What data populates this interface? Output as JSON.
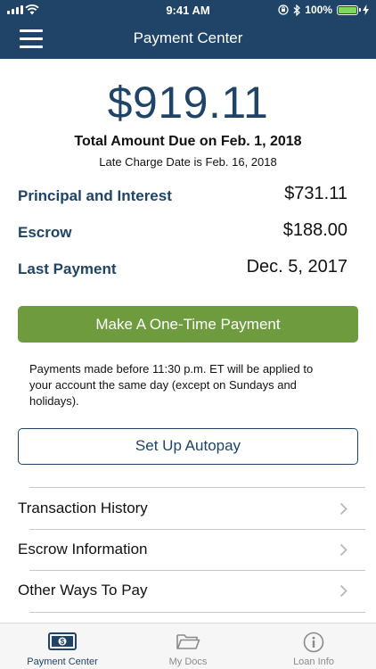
{
  "status_bar": {
    "time": "9:41 AM",
    "battery_percent": "100%",
    "battery_level": 1.0
  },
  "nav": {
    "title": "Payment Center"
  },
  "payment": {
    "amount": "$919.11",
    "due_text": "Total Amount Due on Feb. 1, 2018",
    "late_text": "Late Charge Date is Feb. 16, 2018"
  },
  "details": [
    {
      "label": "Principal and Interest",
      "value": "$731.11"
    },
    {
      "label": "Escrow",
      "value": "$188.00"
    },
    {
      "label": "Last Payment",
      "value": "Dec. 5, 2017"
    }
  ],
  "buttons": {
    "one_time": "Make A One-Time Payment",
    "autopay": "Set Up Autopay"
  },
  "note": "Payments made before 11:30 p.m. ET will be applied to your account the same day (except on Sundays and holidays).",
  "menu_items": [
    {
      "label": "Transaction History"
    },
    {
      "label": "Escrow Information"
    },
    {
      "label": "Other Ways To Pay"
    }
  ],
  "tabs": [
    {
      "label": "Payment Center",
      "icon": "dollar-bill-icon",
      "active": true
    },
    {
      "label": "My Docs",
      "icon": "folder-icon",
      "active": false
    },
    {
      "label": "Loan Info",
      "icon": "info-icon",
      "active": false
    }
  ],
  "colors": {
    "brand_navy": "#1f4467",
    "pay_green": "#6e9b3e",
    "battery_green": "#7ed957"
  }
}
